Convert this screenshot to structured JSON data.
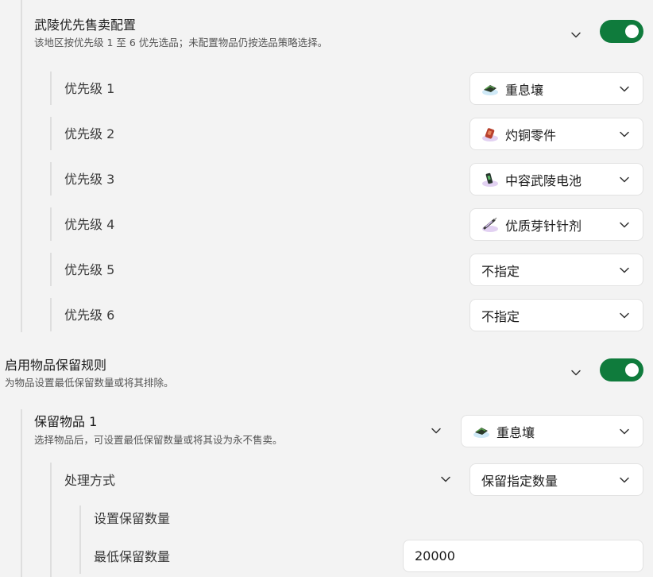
{
  "wuling": {
    "title": "武陵优先售卖配置",
    "desc": "该地区按优先级 1 至 6 优先选品；未配置物品仍按选品策略选择。",
    "enabled": true,
    "priorities": [
      {
        "label": "优先级 1",
        "value": "重息壤",
        "icon": "soil-icon"
      },
      {
        "label": "优先级 2",
        "value": "灼铜零件",
        "icon": "copper-part-icon"
      },
      {
        "label": "优先级 3",
        "value": "中容武陵电池",
        "icon": "battery-icon"
      },
      {
        "label": "优先级 4",
        "value": "优质芽针针剂",
        "icon": "syringe-icon"
      },
      {
        "label": "优先级 5",
        "value": "不指定",
        "icon": ""
      },
      {
        "label": "优先级 6",
        "value": "不指定",
        "icon": ""
      }
    ]
  },
  "retention": {
    "title": "启用物品保留规则",
    "desc": "为物品设置最低保留数量或将其排除。",
    "enabled": true,
    "item": {
      "title": "保留物品 1",
      "desc": "选择物品后，可设置最低保留数量或将其设为永不售卖。",
      "value": "重息壤",
      "icon": "soil-icon"
    },
    "mode": {
      "label": "处理方式",
      "value": "保留指定数量"
    },
    "quantity": {
      "section_title": "设置保留数量",
      "label": "最低保留数量",
      "value": "20000"
    }
  },
  "colors": {
    "accent": "#0f7b3c",
    "background": "#f3f3f3",
    "card": "#ffffff"
  }
}
